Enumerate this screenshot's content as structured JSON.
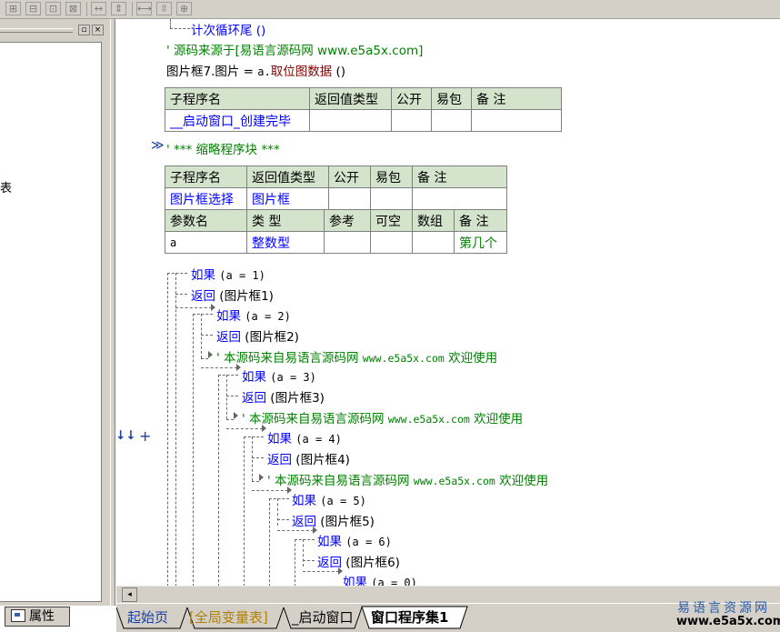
{
  "code": {
    "line_loop_end": "计次循环尾 ()",
    "line_comment_source": "' 源码来源于[易语言源码网 www.e5a5x.com]",
    "line_assign_prefix": "图片框7.图片 = ",
    "line_assign_obj": "a.",
    "line_assign_fn": "取位图数据",
    "line_assign_suffix": " ()",
    "line_thumb_block": "' *** 缩略程序块 ***",
    "thumb_marker": "≫",
    "row_icons": "↓↓",
    "row_plus": "+"
  },
  "table1": {
    "headers": [
      "子程序名",
      "返回值类型",
      "公开",
      "易包",
      "备 注"
    ],
    "row": [
      "__启动窗口_创建完毕",
      "",
      "",
      "",
      ""
    ]
  },
  "table2": {
    "headers": [
      "子程序名",
      "返回值类型",
      "公开",
      "易包",
      "备 注"
    ],
    "row": [
      "图片框选择",
      "图片框",
      "",
      "",
      ""
    ],
    "param_headers": [
      "参数名",
      "类 型",
      "参考",
      "可空",
      "数组",
      "备 注"
    ],
    "param_row": [
      "a",
      "整数型",
      "",
      "",
      "",
      "第几个"
    ]
  },
  "flow": {
    "kw_if": "如果",
    "kw_return": "返回",
    "lines": [
      {
        "type": "if",
        "cond": "(a = 1)"
      },
      {
        "type": "return",
        "arg": "(图片框1)"
      },
      {
        "type": "if",
        "cond": "(a = 2)"
      },
      {
        "type": "return",
        "arg": "(图片框2)"
      },
      {
        "type": "comment",
        "text": "' 本源码来自易语言源码网 ",
        "url": "www.e5a5x.com",
        "tail": " 欢迎使用"
      },
      {
        "type": "if",
        "cond": "(a = 3)"
      },
      {
        "type": "return",
        "arg": "(图片框3)"
      },
      {
        "type": "comment",
        "text": "' 本源码来自易语言源码网 ",
        "url": "www.e5a5x.com",
        "tail": " 欢迎使用"
      },
      {
        "type": "if",
        "cond": "(a = 4)"
      },
      {
        "type": "return",
        "arg": "(图片框4)"
      },
      {
        "type": "comment",
        "text": "' 本源码来自易语言源码网 ",
        "url": "www.e5a5x.com",
        "tail": " 欢迎使用"
      },
      {
        "type": "if",
        "cond": "(a = 5)"
      },
      {
        "type": "return",
        "arg": "(图片框5)"
      },
      {
        "type": "if",
        "cond": "(a = 6)"
      },
      {
        "type": "return",
        "arg": "(图片框6)"
      },
      {
        "type": "if",
        "cond": "(a = 0)"
      }
    ]
  },
  "left_pane": {
    "truncated_text": "表",
    "props_tab": "属性",
    "min_glyph": "▫",
    "close_glyph": "×"
  },
  "toolbar": {
    "buttons": [
      "⊞",
      "⊟",
      "⊡",
      "⊠",
      "↔",
      "⇕",
      "⟷",
      "⇳",
      "⊕"
    ]
  },
  "scroll": {
    "left_arrow": "◂"
  },
  "tabs": [
    "起始页",
    "[全局变量表]",
    "_启动窗口",
    "窗口程序集1"
  ],
  "watermark": {
    "line1": "易语言资源网",
    "line2": "www.e5a5x.com"
  },
  "colors": {
    "keyword": "#0000ff",
    "comment": "#008000",
    "function": "#800000",
    "table_header": "#d4e4cc",
    "chrome": "#d4d0c8"
  }
}
